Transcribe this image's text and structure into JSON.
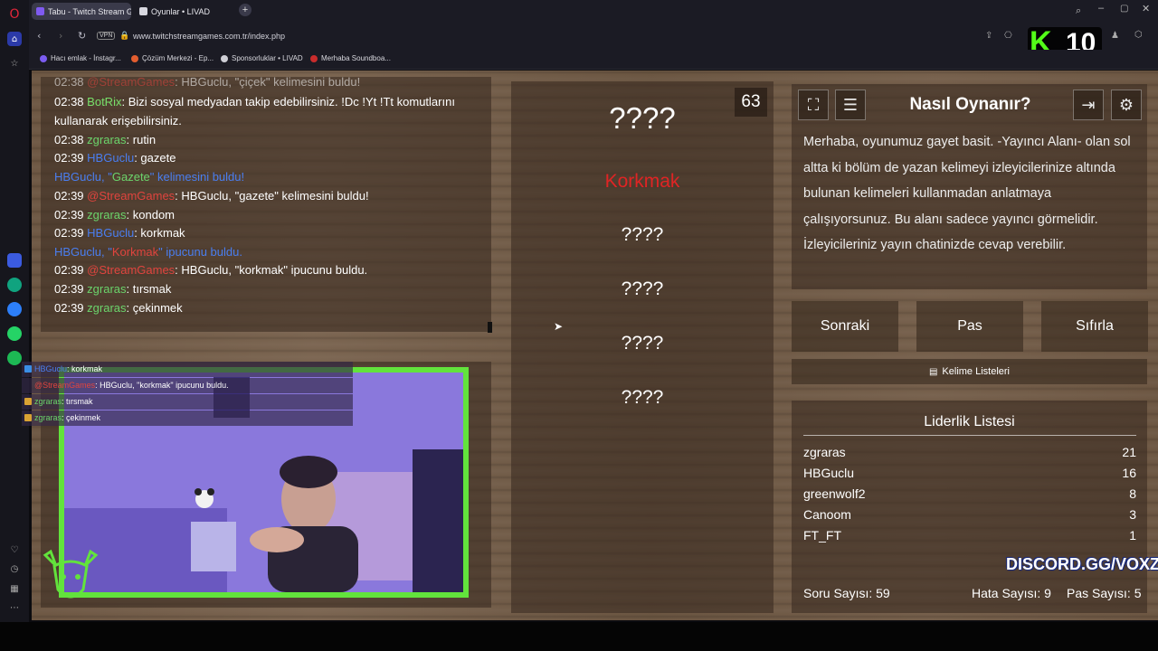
{
  "browser": {
    "tabs": [
      {
        "label": "Tabu - Twitch Stream Gam"
      },
      {
        "label": "Oyunlar • LIVAD"
      }
    ],
    "new_tab_label": "+",
    "url": "www.twitchstreamgames.com.tr/index.php",
    "vpn_badge": "VPN",
    "bookmarks": [
      {
        "label": "Hacı emlak - İnstagr...",
        "color": "#7b5cf0"
      },
      {
        "label": "Çözüm Merkezi - Ep...",
        "color": "#e25d2f"
      },
      {
        "label": "Sponsorluklar • LIVAD",
        "color": "#cfcfd6"
      },
      {
        "label": "Merhaba Soundboa...",
        "color": "#c92c2c"
      }
    ],
    "kick_overlay": {
      "logo": "K",
      "count": "10"
    }
  },
  "chat": {
    "lines": [
      {
        "time": "02:38",
        "user": "@StreamGames",
        "user_color": "red",
        "text": ": HBGuclu, \"çiçek\" kelimesini buldu!"
      },
      {
        "time": "02:38",
        "user": "BotRix",
        "user_color": "bot",
        "text": ": Bizi sosyal medyadan takip edebilirsiniz. !Dc !Yt !Tt komutlarını"
      },
      {
        "time": "",
        "user": "",
        "user_color": "",
        "text": "kullanarak erişebilirsiniz."
      },
      {
        "time": "02:38",
        "user": "zgraras",
        "user_color": "green",
        "text": ": rutin"
      },
      {
        "time": "02:39",
        "user": "HBGuclu",
        "user_color": "blue",
        "text": ": gazete"
      },
      {
        "time": "02:39",
        "user": "@StreamGames",
        "user_color": "red",
        "text": ": HBGuclu, \"gazete\" kelimesini buldu!"
      },
      {
        "time": "02:39",
        "user": "zgraras",
        "user_color": "green",
        "text": ": kondom"
      },
      {
        "time": "02:39",
        "user": "HBGuclu",
        "user_color": "blue",
        "text": ": korkmak"
      },
      {
        "time": "02:39",
        "user": "@StreamGames",
        "user_color": "red",
        "text": ": HBGuclu, \"korkmak\" ipucunu buldu."
      },
      {
        "time": "02:39",
        "user": "zgraras",
        "user_color": "green",
        "text": ": tırsmak"
      },
      {
        "time": "02:39",
        "user": "zgraras",
        "user_color": "green",
        "text": ": çekinmek"
      }
    ],
    "system_1": {
      "user": "HBGuclu",
      "sep": ", \"",
      "word": "Gazete",
      "rest": "\" kelimesini buldu!"
    },
    "system_2": {
      "user": "HBGuclu",
      "sep": ", \"",
      "word": "Korkmak",
      "rest": "\" ipucunu buldu."
    }
  },
  "stream_overlay": {
    "lines": [
      {
        "user": "HBGuclu",
        "text": ": korkmak"
      },
      {
        "user": "@StreamGames",
        "text": ": HBGuclu, \"korkmak\" ipucunu buldu."
      },
      {
        "user": "zgraras",
        "text": ": tırsmak"
      },
      {
        "user": "zgraras",
        "text": ": çekinmek"
      }
    ]
  },
  "game": {
    "timer": "63",
    "main_word": "????",
    "hint_found": "Korkmak",
    "hints": [
      "????",
      "????",
      "????",
      "????"
    ]
  },
  "howto": {
    "title": "Nasıl Oynanır?",
    "body": "Merhaba, oyunumuz gayet basit. -Yayıncı Alanı- olan sol altta ki bölüm de yazan kelimeyi izleyicilerinize altında bulunan kelimeleri kullanmadan anlatmaya çalışıyorsunuz. Bu alanı sadece yayıncı görmelidir. İzleyicileriniz yayın chatinizde cevap verebilir."
  },
  "controls": {
    "next": "Sonraki",
    "pass": "Pas",
    "reset": "Sıfırla",
    "word_lists": "Kelime Listeleri"
  },
  "leaderboard": {
    "title": "Liderlik Listesi",
    "rows": [
      {
        "name": "zgraras",
        "score": "21"
      },
      {
        "name": "HBGuclu",
        "score": "16"
      },
      {
        "name": "greenwolf2",
        "score": "8"
      },
      {
        "name": "Canoom",
        "score": "3"
      },
      {
        "name": "FT_FT",
        "score": "1"
      }
    ],
    "discord": "DISCORD.GG/VOXZ"
  },
  "stats": {
    "questions": "Soru Sayısı: 59",
    "errors": "Hata Sayısı: 9",
    "passes": "Pas Sayısı: 5"
  }
}
